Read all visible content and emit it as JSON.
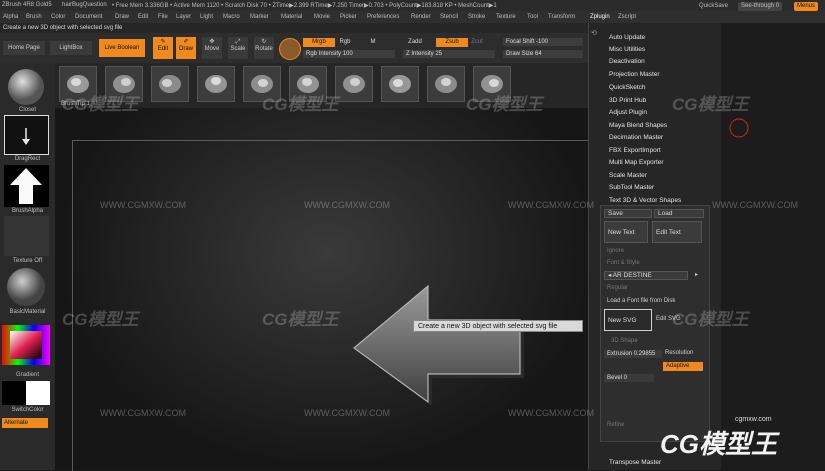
{
  "titlebar": {
    "app_title": "ZBrush 4R8 Gold5",
    "project": "hairBugQuestion",
    "stats": "• Free Mem 3.336GB • Active Mem 1120 • Scratch Disk 70 • ZTime▶2.399 RTime▶7.250 Timer▶0.703 • PolyCount▶183.818 KP • MeshCount▶1",
    "quicksave": "QuickSave",
    "seethrough": "See-through 0",
    "menus_btn": "Menus"
  },
  "menubar": [
    "Alpha",
    "Brush",
    "Color",
    "Document",
    "Draw",
    "Edit",
    "File",
    "Layer",
    "Light",
    "Macro",
    "Marker",
    "Material",
    "Movie",
    "Picker",
    "Preferences",
    "Render",
    "Stencil",
    "Stroke",
    "Texture",
    "Tool",
    "Transform",
    "Zplugin",
    "Zscript"
  ],
  "hint": "Create a new 3D object with selected svg file",
  "shelf": {
    "home_page": "Home Page",
    "lightbox": "LightBox",
    "live_boolean": "Live Boolean",
    "edit": "Edit",
    "draw": "Draw",
    "move": "Move",
    "scale": "Scale",
    "rotate": "Rotate",
    "mrgb": "Mrgb",
    "rgb": "Rgb",
    "m": "M",
    "zadd": "Zadd",
    "zsub": "Zsub",
    "zcut": "Zcut",
    "rgb_intensity": "Rgb Intensity 100",
    "z_intensity": "Z Intensity 25",
    "focal_shift": "Focal Shift -100",
    "draw_size": "Draw Size 64"
  },
  "brushes": {
    "count": 10,
    "label": "BrushTip 1"
  },
  "lefttray": {
    "closet": "Closet",
    "dragrect": "DragRect",
    "brushalpha": "BrushAlpha",
    "texture_off": "Texture Off",
    "basic_material": "BasicMaterial",
    "gradient": "Gradient",
    "switch_color": "SwitchColor",
    "alternate": "Alternate"
  },
  "zplugin": {
    "items": [
      "Auto Update",
      "Misc Utilities",
      "Deactivation",
      "Projection Master",
      "QuickSketch",
      "3D Print Hub",
      "Adjust Plugin",
      "Maya Blend Shapes",
      "Decimation Master",
      "FBX ExportImport",
      "Multi Map Exporter",
      "Scale Master",
      "SubTool Master",
      "Text 3D & Vector Shapes"
    ],
    "footer": "Transpose Master"
  },
  "textpanel": {
    "save": "Save",
    "load": "Load",
    "new_text": "New Text",
    "edit_text": "Edit Text",
    "font_label": "Font & Style",
    "font_value": "AR DESTINE",
    "regular": "Regular",
    "load_font": "Load a Font file from Disk",
    "new_svg": "New SVG",
    "edit_svg": "Edit SVG",
    "shape_3d": "3D Shape",
    "extrusion": "Extrusion 0.29855",
    "resolution": "Resolution",
    "adaptive": "Adaptive",
    "bevel": "Bevel 0",
    "refine": "Refine"
  },
  "tooltip": "Create a new 3D object with selected svg file",
  "watermark": {
    "url": "WWW.CGMXW.COM",
    "brand": "CG模型王",
    "small": "cgmxw.com"
  },
  "colors": {
    "accent": "#f08a1c",
    "panel": "#2a2a2a",
    "canvas": "#161616"
  }
}
